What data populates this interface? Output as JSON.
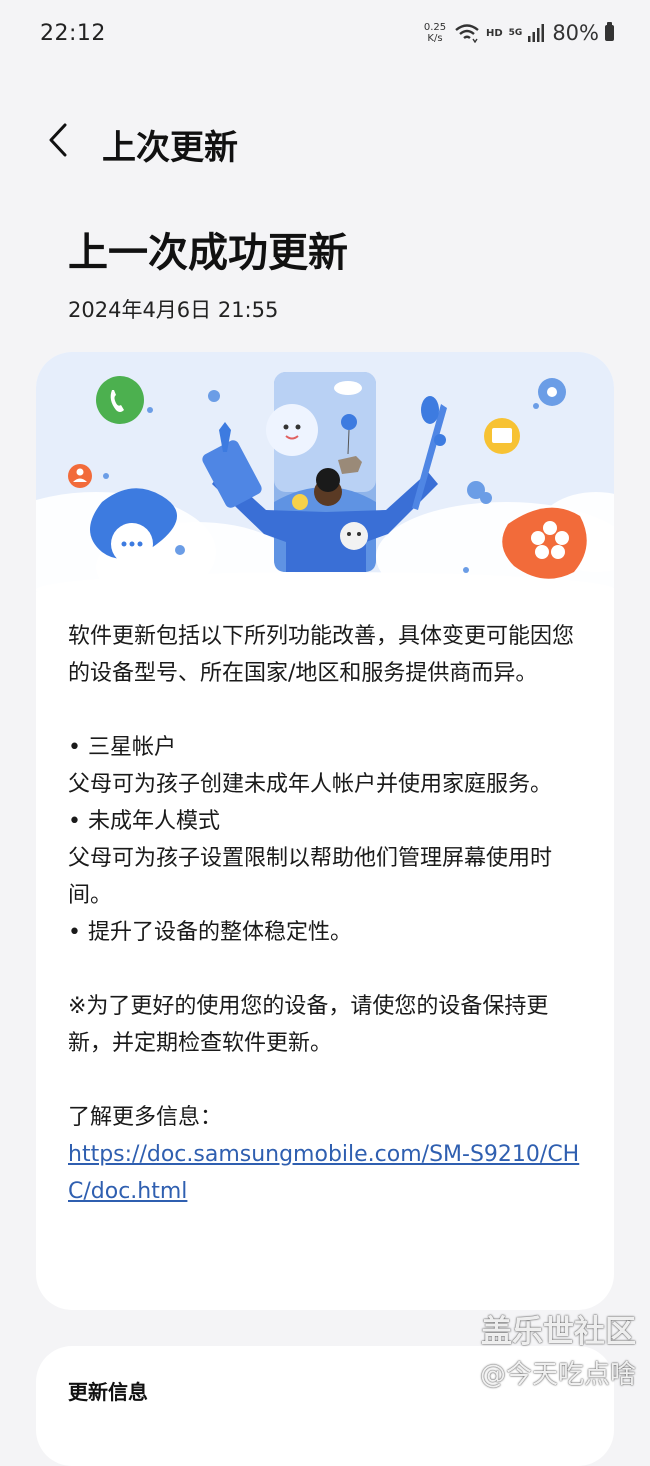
{
  "status_bar": {
    "time": "22:12",
    "net_speed_value": "0.25",
    "net_speed_unit": "K/s",
    "hd": "HD",
    "network": "5G",
    "battery": "80%"
  },
  "header": {
    "title": "上次更新"
  },
  "last_update": {
    "heading": "上一次成功更新",
    "date": "2024年4月6日 21:55"
  },
  "details": {
    "intro": "软件更新包括以下所列功能改善，具体变更可能因您的设备型号、所在国家/地区和服务提供商而异。",
    "items": [
      {
        "title": "• 三星帐户",
        "desc": "父母可为孩子创建未成年人帐户并使用家庭服务。"
      },
      {
        "title": "• 未成年人模式",
        "desc": "父母可为孩子设置限制以帮助他们管理屏幕使用时间。"
      },
      {
        "title": "• 提升了设备的整体稳定性。",
        "desc": ""
      }
    ],
    "note": "※为了更好的使用您的设备，请使您的设备保持更新，并定期检查软件更新。",
    "more_label": "了解更多信息：",
    "more_link": "https://doc.samsungmobile.com/SM-S9210/CHC/doc.html"
  },
  "update_info": {
    "title": "更新信息"
  },
  "watermark": {
    "line1": "盖乐世社区",
    "line2": "@今天吃点啥"
  },
  "colors": {
    "background": "#f4f4f6",
    "card": "#ffffff",
    "link": "#2f5fb0",
    "banner_sky": "#e6eefb",
    "accent_orange": "#f26b3a",
    "accent_blue": "#3d7be0",
    "accent_green": "#4cb04f",
    "accent_yellow": "#f7c233"
  },
  "icons": [
    "back-arrow-icon",
    "wifi-icon",
    "signal-icon",
    "battery-icon",
    "phone-app-icon",
    "chat-app-icon",
    "contact-app-icon",
    "settings-app-icon",
    "folder-app-icon",
    "flower-app-icon"
  ]
}
